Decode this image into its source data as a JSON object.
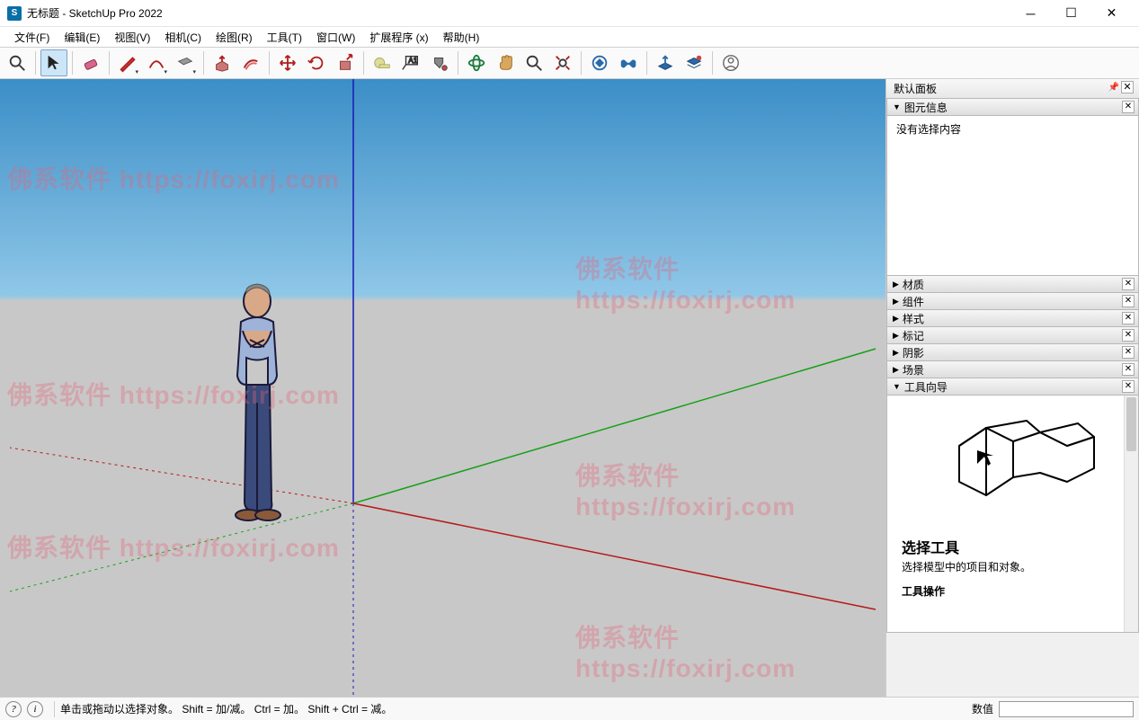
{
  "titlebar": {
    "title": "无标题 - SketchUp Pro 2022"
  },
  "menubar": {
    "items": [
      "文件(F)",
      "编辑(E)",
      "视图(V)",
      "相机(C)",
      "绘图(R)",
      "工具(T)",
      "窗口(W)",
      "扩展程序 (x)",
      "帮助(H)"
    ]
  },
  "toolbar": {
    "tools": [
      {
        "name": "search-icon"
      },
      {
        "name": "select-icon",
        "active": true
      },
      {
        "name": "eraser-icon"
      },
      {
        "name": "pencil-icon",
        "dd": true
      },
      {
        "name": "arc-icon",
        "dd": true
      },
      {
        "name": "rectangle-icon",
        "dd": true
      },
      {
        "name": "pushpull-icon"
      },
      {
        "name": "offset-icon"
      },
      {
        "name": "move-icon"
      },
      {
        "name": "rotate-icon"
      },
      {
        "name": "scale-icon"
      },
      {
        "name": "tape-icon"
      },
      {
        "name": "text-icon"
      },
      {
        "name": "paint-icon"
      },
      {
        "name": "orbit-icon"
      },
      {
        "name": "pan-icon"
      },
      {
        "name": "zoom-icon"
      },
      {
        "name": "zoom-extents-icon"
      },
      {
        "name": "warehouse-icon"
      },
      {
        "name": "ext-warehouse-icon"
      },
      {
        "name": "geolocation-icon"
      },
      {
        "name": "layers-icon"
      },
      {
        "name": "account-icon"
      }
    ]
  },
  "side": {
    "default_tray_title": "默认面板",
    "entity_info": {
      "title": "图元信息",
      "empty": "没有选择内容",
      "expanded": true
    },
    "panels": [
      {
        "title": "材质"
      },
      {
        "title": "组件"
      },
      {
        "title": "样式"
      },
      {
        "title": "标记"
      },
      {
        "title": "阴影"
      },
      {
        "title": "场景"
      }
    ],
    "instructor": {
      "title": "工具向导",
      "tool_name": "选择工具",
      "tool_desc": "选择模型中的项目和对象。",
      "sub": "工具操作"
    }
  },
  "statusbar": {
    "hint": "单击或拖动以选择对象。 Shift = 加/减。 Ctrl = 加。 Shift + Ctrl = 减。",
    "vcb_label": "数值",
    "vcb_value": ""
  },
  "watermarks": {
    "text": "佛系软件 https://foxirj.com"
  }
}
